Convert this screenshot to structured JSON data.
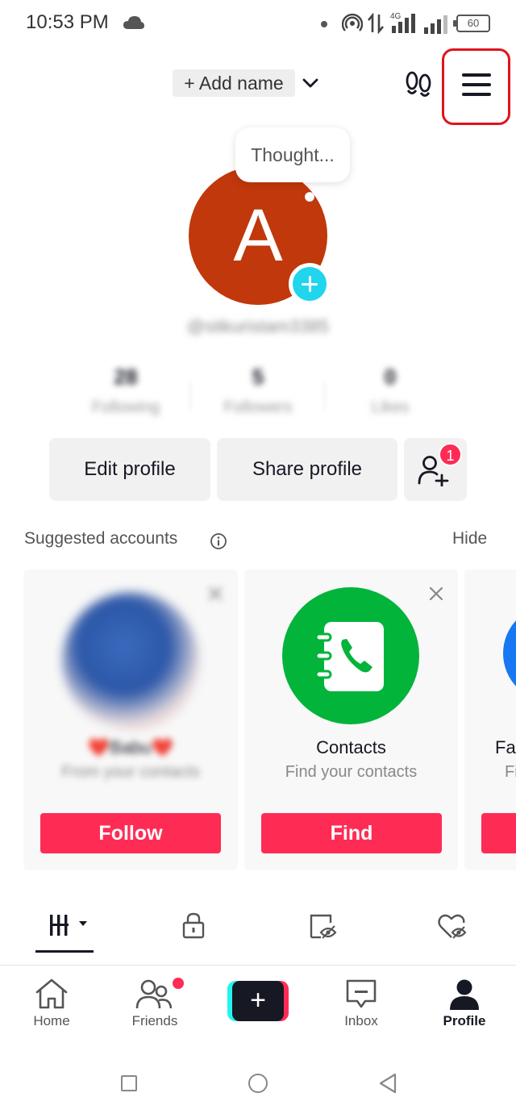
{
  "status_bar": {
    "time": "10:53 PM",
    "battery": "60",
    "network": "4G",
    "icons": [
      "cloud-icon",
      "hotspot-icon",
      "data-transfer-icon",
      "signal-icon",
      "battery-icon"
    ]
  },
  "header": {
    "add_name": "+ Add name",
    "menu_highlight_color": "#e0141b"
  },
  "profile": {
    "avatar_letter": "A",
    "avatar_color": "#c0380b",
    "thought_bubble": "Thought...",
    "username": "@sitkuristam3385",
    "stats": [
      {
        "value": "28",
        "label": "Following"
      },
      {
        "value": "5",
        "label": "Followers"
      },
      {
        "value": "0",
        "label": "Likes"
      }
    ],
    "edit_profile": "Edit profile",
    "share_profile": "Share profile",
    "add_friend_badge": "1"
  },
  "suggested": {
    "title": "Suggested accounts",
    "hide": "Hide",
    "cards": [
      {
        "name": "❤️Babu❤️",
        "subtitle": "From your contacts",
        "button": "Follow"
      },
      {
        "name": "Contacts",
        "subtitle": "Find your contacts",
        "button": "Find"
      },
      {
        "name": "Fa",
        "subtitle": "Fi",
        "button": ""
      }
    ]
  },
  "tabs": [
    "videos-grid-icon",
    "private-lock-icon",
    "reposts-icon",
    "liked-icon"
  ],
  "bottom_nav": {
    "home": "Home",
    "friends": "Friends",
    "create": "+",
    "inbox": "Inbox",
    "profile": "Profile"
  },
  "colors": {
    "accent": "#fe2c55",
    "cyan": "#25f4ee",
    "contacts_green": "#03b43b"
  }
}
